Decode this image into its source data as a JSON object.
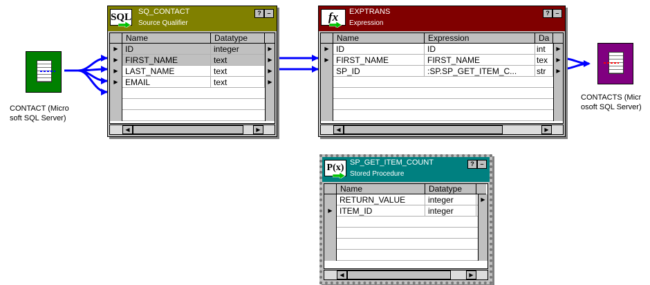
{
  "source": {
    "label": "CONTACT (Micro\nsoft SQL Server)",
    "color": "#008000",
    "icon": "table-source-icon"
  },
  "target": {
    "label": "CONTACTS (Micr\nosoft SQL Server)",
    "color": "#800080",
    "icon": "table-target-icon"
  },
  "sq": {
    "icon_text": "SQL",
    "name": "SQ_CONTACT",
    "type": "Source Qualifier",
    "title_color": "#808000",
    "columns": [
      "Name",
      "Datatype"
    ],
    "rows": [
      {
        "name": "ID",
        "datatype": "integer"
      },
      {
        "name": "FIRST_NAME",
        "datatype": "text"
      },
      {
        "name": "LAST_NAME",
        "datatype": "text"
      },
      {
        "name": "EMAIL",
        "datatype": "text"
      }
    ]
  },
  "exp": {
    "icon_text": "fx",
    "name": "EXPTRANS",
    "type": "Expression",
    "title_color": "#800000",
    "columns": [
      "Name",
      "Expression",
      "Da"
    ],
    "rows": [
      {
        "name": "ID",
        "expression": "ID",
        "datatype": "int"
      },
      {
        "name": "FIRST_NAME",
        "expression": "FIRST_NAME",
        "datatype": "tex"
      },
      {
        "name": "SP_ID",
        "expression": ":SP.SP_GET_ITEM_C...",
        "datatype": "str"
      }
    ]
  },
  "sp": {
    "icon_text": "P(x)",
    "name": "SP_GET_ITEM_COUNT",
    "type": "Stored Procedure",
    "title_color": "#008080",
    "columns": [
      "Name",
      "Datatype"
    ],
    "rows": [
      {
        "name": "RETURN_VALUE",
        "datatype": "integer"
      },
      {
        "name": "ITEM_ID",
        "datatype": "integer"
      }
    ]
  },
  "window_buttons": {
    "help": "?",
    "minimize": "–"
  }
}
